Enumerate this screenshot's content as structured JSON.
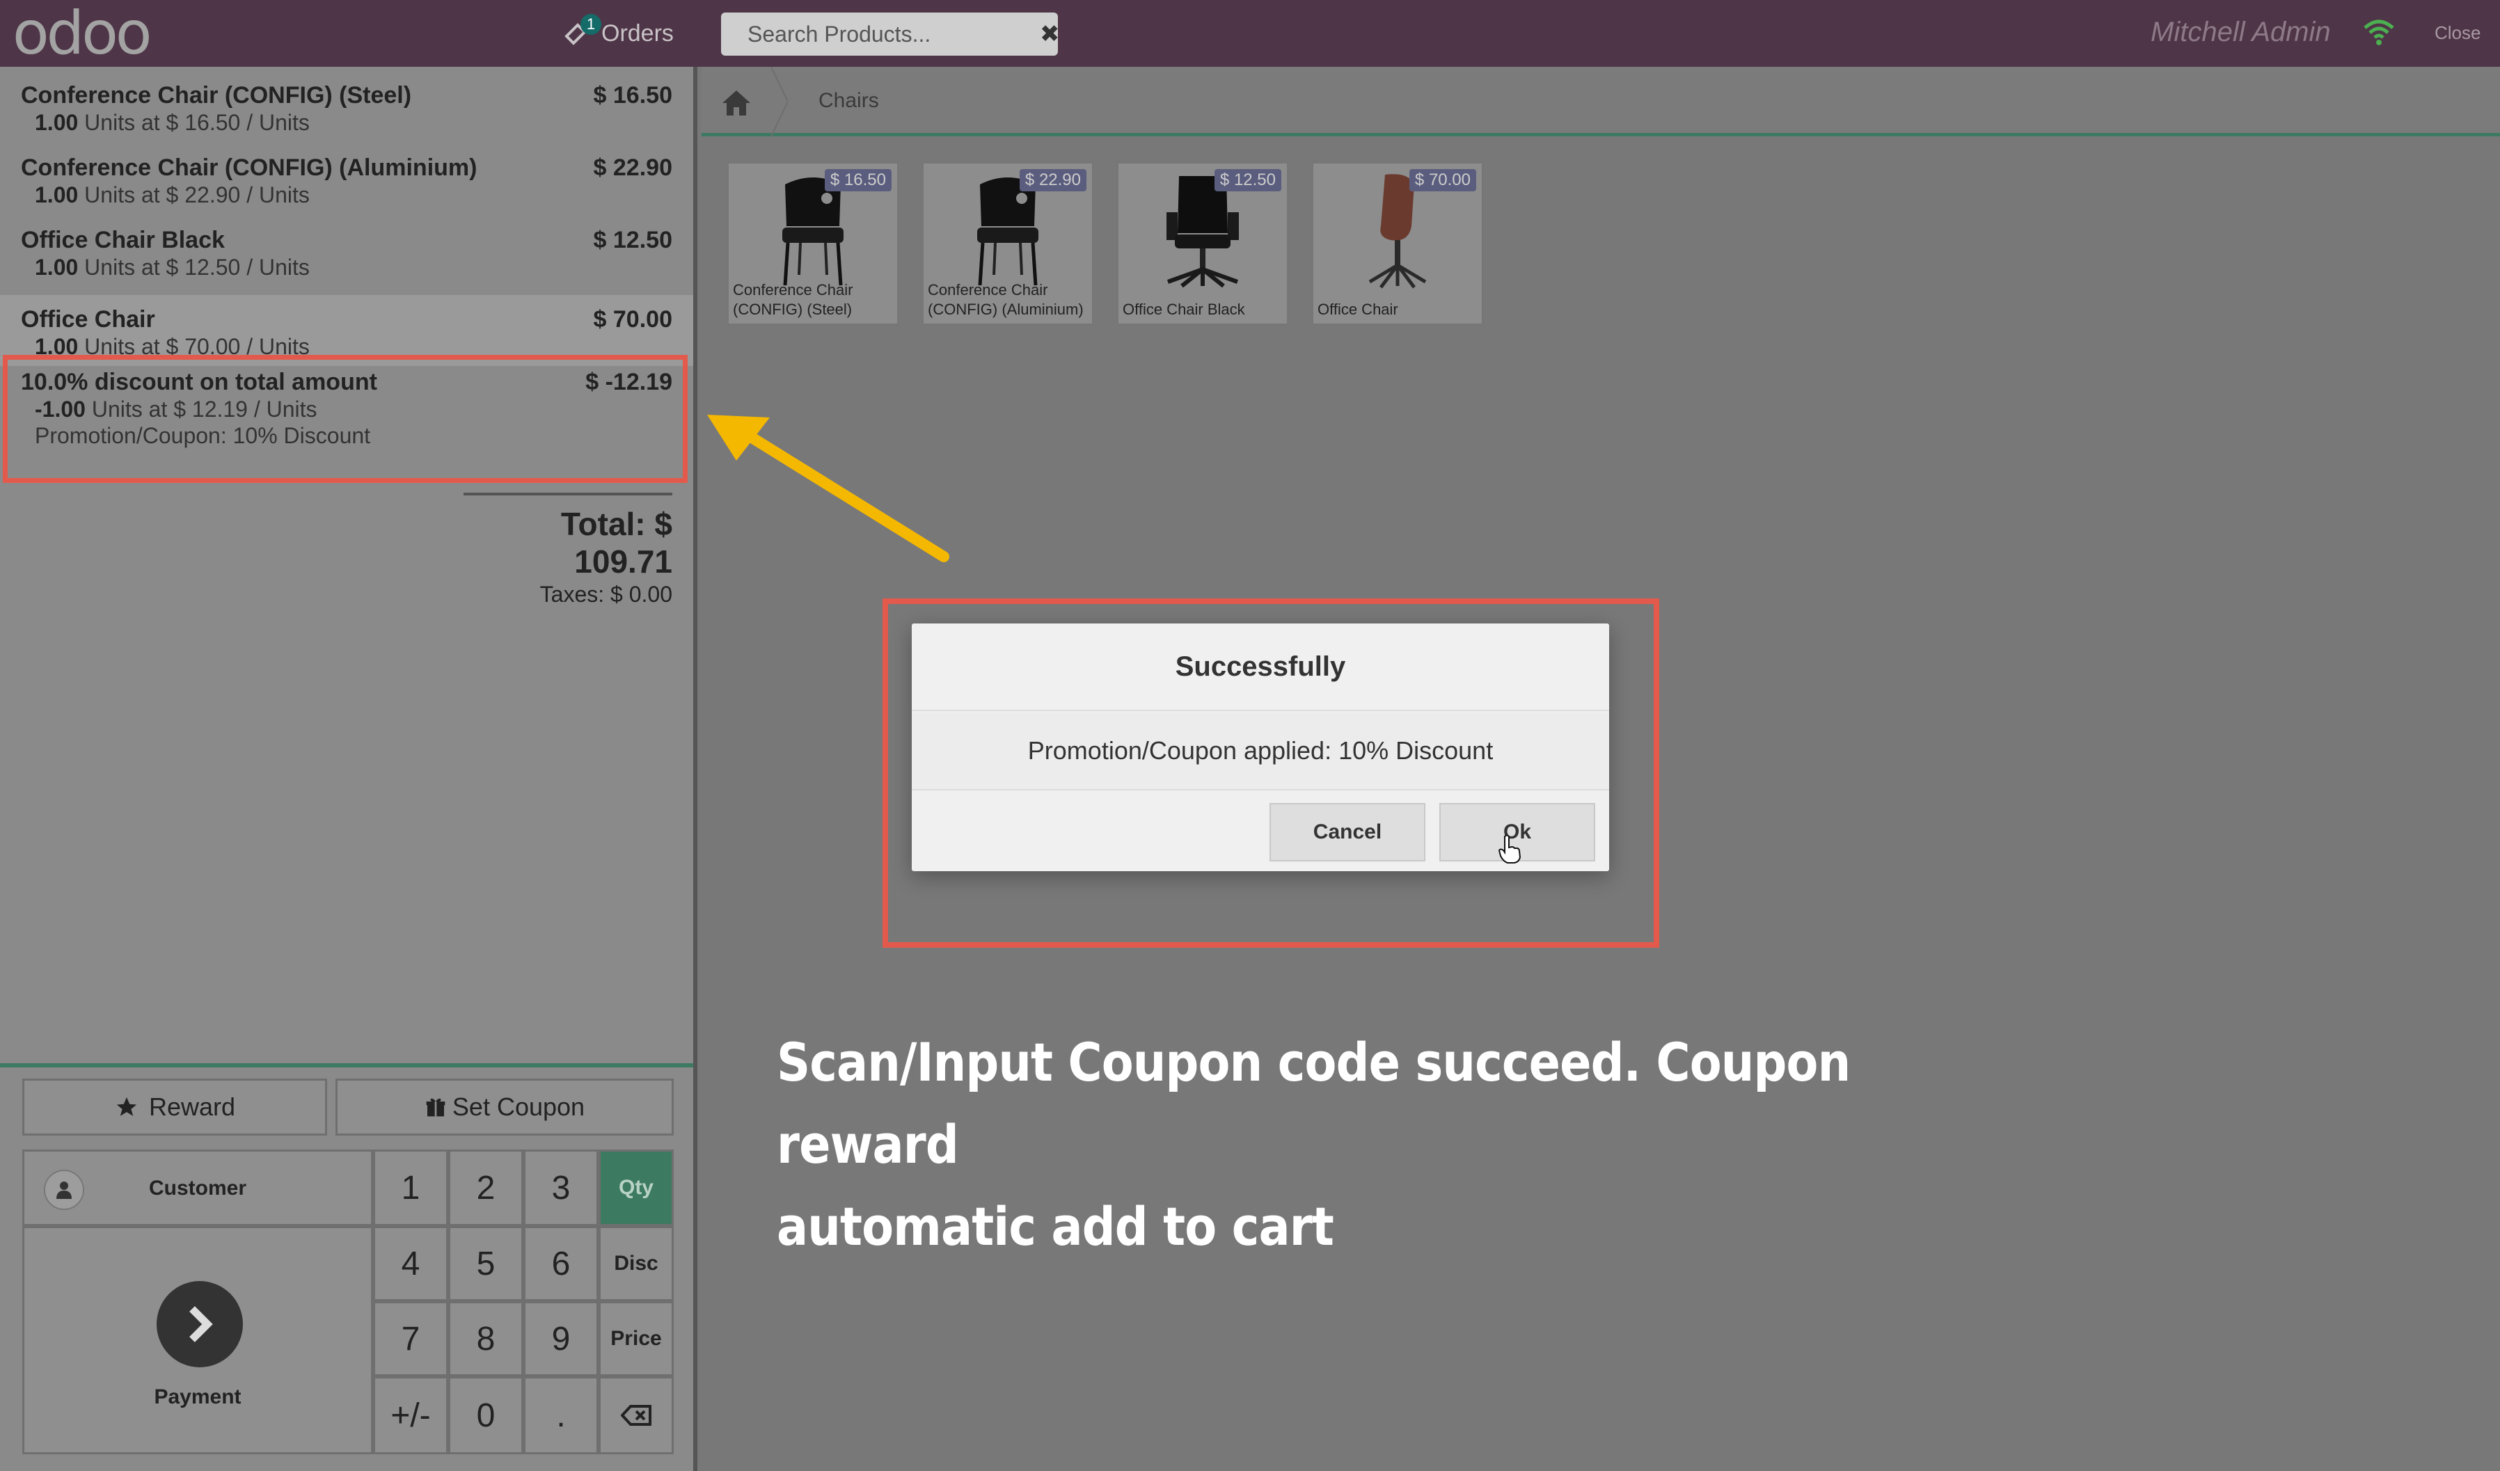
{
  "topbar": {
    "logo": "odoo",
    "orders_label": "Orders",
    "orders_badge": "1",
    "search_placeholder": "Search Products...",
    "user_name": "Mitchell Admin",
    "close_label": "Close"
  },
  "order": {
    "lines": [
      {
        "name": "Conference Chair (CONFIG) (Steel)",
        "price": "$ 16.50",
        "qty": "1.00",
        "info": " Units at $ 16.50 / Units"
      },
      {
        "name": "Conference Chair (CONFIG) (Aluminium)",
        "price": "$ 22.90",
        "qty": "1.00",
        "info": " Units at $ 22.90 / Units"
      },
      {
        "name": "Office Chair Black",
        "price": "$ 12.50",
        "qty": "1.00",
        "info": " Units at $ 12.50 / Units"
      },
      {
        "name": "Office Chair",
        "price": "$ 70.00",
        "qty": "1.00",
        "info": " Units at $ 70.00 / Units"
      },
      {
        "name": "10.0% discount on total amount",
        "price": "$ -12.19",
        "qty": "-1.00",
        "info": " Units at $ 12.19 / Units",
        "promo": "Promotion/Coupon: 10% Discount"
      }
    ],
    "total": "Total: $ 109.71",
    "taxes": "Taxes: $ 0.00"
  },
  "controls": {
    "reward_label": "Reward",
    "set_coupon_label": "Set Coupon",
    "customer_label": "Customer",
    "payment_label": "Payment",
    "keys": [
      "1",
      "2",
      "3",
      "4",
      "5",
      "6",
      "7",
      "8",
      "9",
      "+/-",
      "0",
      "."
    ],
    "modes": [
      "Qty",
      "Disc",
      "Price"
    ],
    "active_mode": "Qty"
  },
  "breadcrumb": {
    "category": "Chairs"
  },
  "products": [
    {
      "name": "Conference Chair (CONFIG) (Steel)",
      "price": "$ 16.50"
    },
    {
      "name": "Conference Chair (CONFIG) (Aluminium)",
      "price": "$ 22.90"
    },
    {
      "name": "Office Chair Black",
      "price": "$ 12.50"
    },
    {
      "name": "Office Chair",
      "price": "$ 70.00"
    }
  ],
  "dialog": {
    "title": "Successfully",
    "message": "Promotion/Coupon applied: 10% Discount",
    "cancel_label": "Cancel",
    "ok_label": "Ok"
  },
  "annotation": {
    "line1": "Scan/Input Coupon code succeed. Coupon reward",
    "line2": "automatic add to cart"
  },
  "colors": {
    "topbar": "#4e3547",
    "accent_green": "#3d7a62",
    "highlight_red": "#e35a4d",
    "arrow_yellow": "#f5b800"
  }
}
